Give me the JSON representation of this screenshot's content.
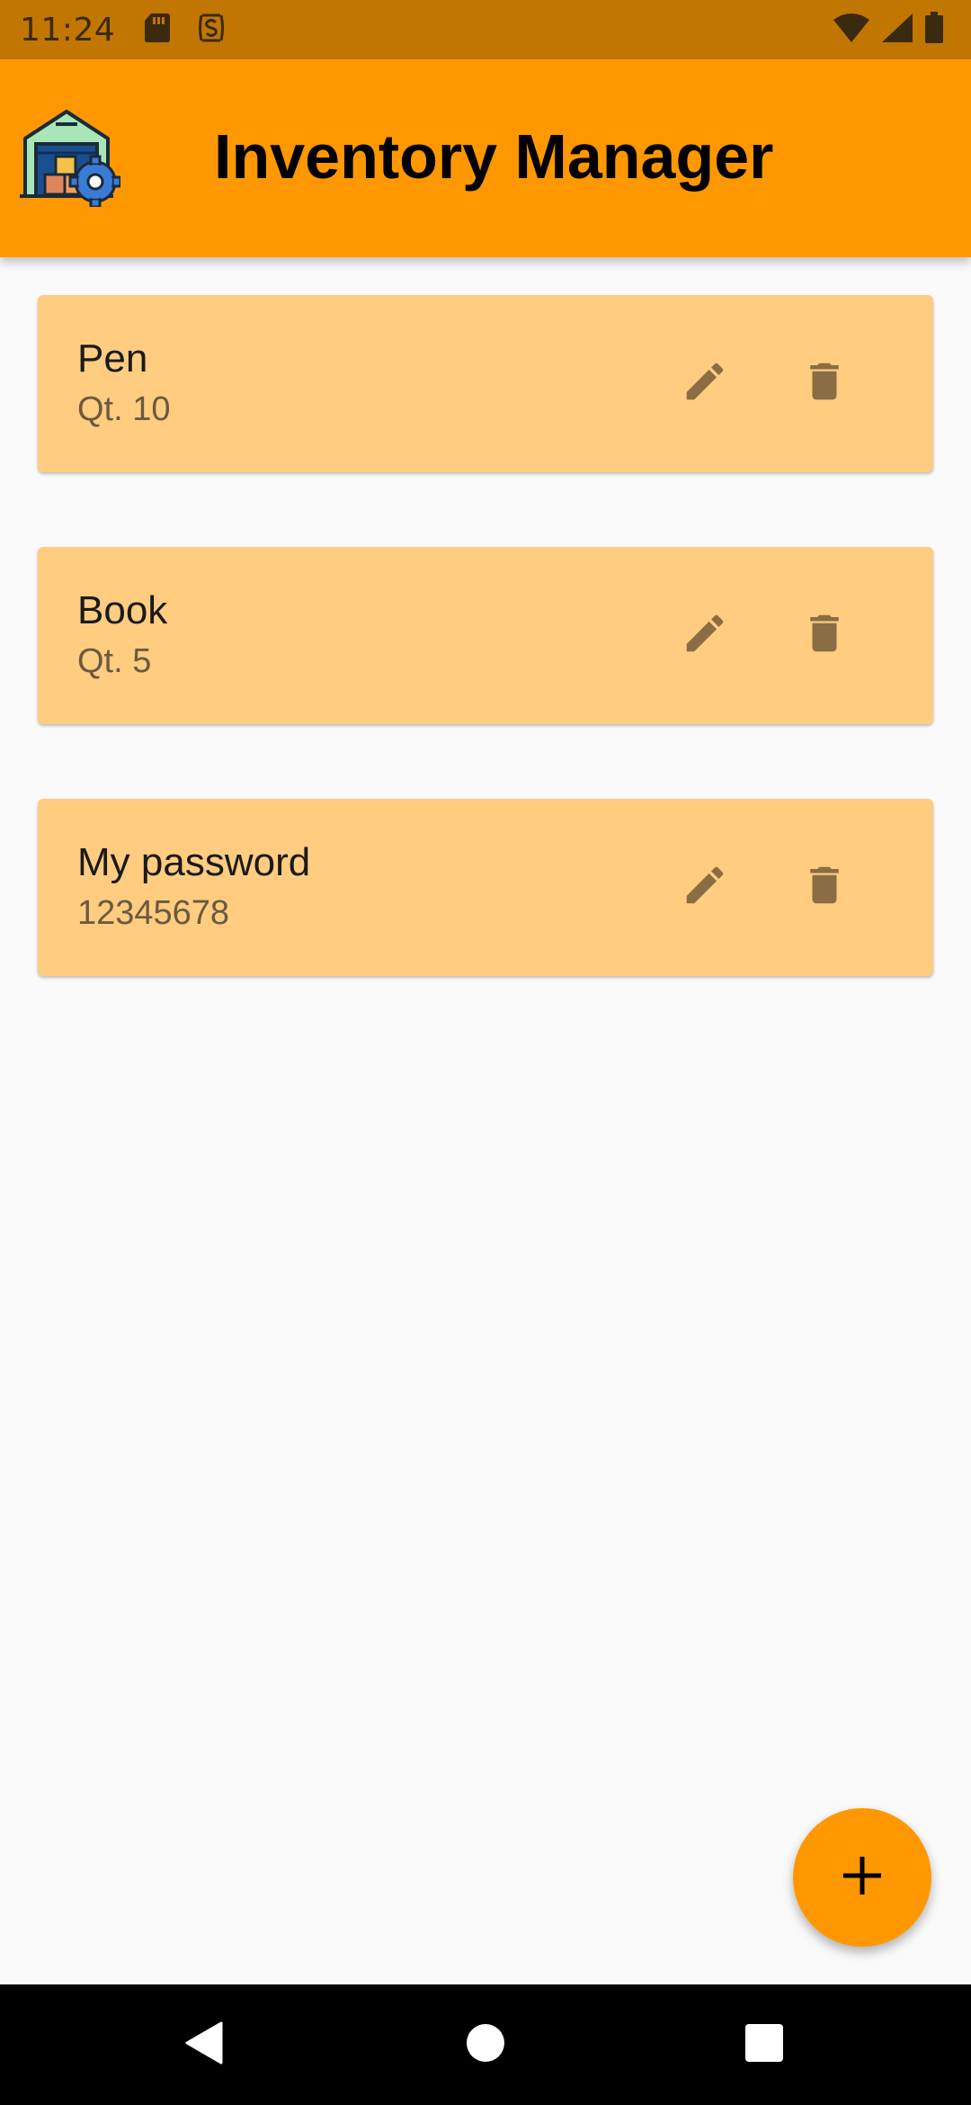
{
  "status_bar": {
    "time": "11:24",
    "icons": [
      "sd-card-icon",
      "screen-record-icon",
      "wifi-icon",
      "signal-icon",
      "battery-icon"
    ]
  },
  "app_bar": {
    "title": "Inventory Manager",
    "logo": "warehouse-logo-icon",
    "color": "#ff9800"
  },
  "items": [
    {
      "name": "Pen",
      "detail": "Qt. 10"
    },
    {
      "name": "Book",
      "detail": "Qt. 5"
    },
    {
      "name": "My password",
      "detail": "12345678"
    }
  ],
  "item_actions": {
    "edit_icon": "pencil-icon",
    "delete_icon": "trash-icon"
  },
  "fab": {
    "icon": "plus-icon"
  },
  "nav_bar": {
    "buttons": [
      "back-icon",
      "home-icon",
      "recents-icon"
    ]
  },
  "colors": {
    "status_bar": "#c17600",
    "card": "#ffcc80",
    "icon": "#8a6d45"
  }
}
